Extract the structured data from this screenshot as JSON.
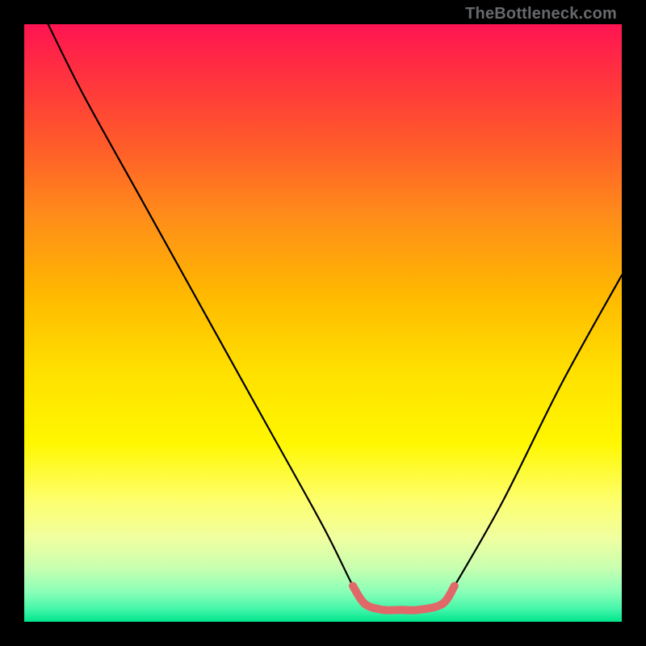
{
  "watermark": "TheBottleneck.com",
  "chart_data": {
    "type": "line",
    "title": "",
    "xlabel": "",
    "ylabel": "",
    "xlim": [
      0,
      100
    ],
    "ylim": [
      0,
      100
    ],
    "series": [
      {
        "name": "curve",
        "x": [
          4,
          10,
          20,
          30,
          40,
          50,
          55,
          57,
          60,
          63,
          66,
          70,
          72,
          80,
          90,
          100
        ],
        "values": [
          100,
          88,
          70,
          52,
          34,
          16,
          6,
          3,
          2,
          2,
          2,
          3,
          6,
          20,
          40,
          58
        ]
      },
      {
        "name": "highlight-segment",
        "x": [
          55,
          57,
          60,
          63,
          66,
          70,
          72
        ],
        "values": [
          6,
          3,
          2,
          2,
          2,
          3,
          6
        ]
      }
    ],
    "gradient_stops": [
      {
        "pos": 0,
        "color": "#ff1452"
      },
      {
        "pos": 20,
        "color": "#ff5a2a"
      },
      {
        "pos": 45,
        "color": "#ffb800"
      },
      {
        "pos": 70,
        "color": "#fff700"
      },
      {
        "pos": 90,
        "color": "#c8ffb0"
      },
      {
        "pos": 100,
        "color": "#00e58c"
      }
    ],
    "highlight_color": "#e06868",
    "curve_color": "#000000"
  }
}
